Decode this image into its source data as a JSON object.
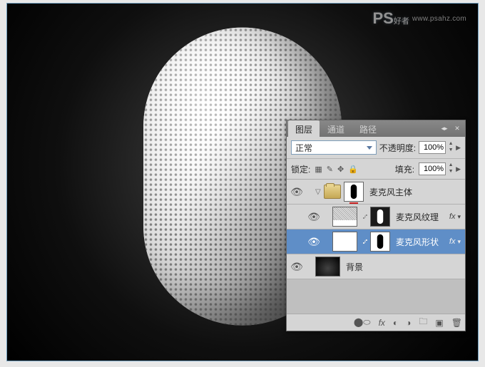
{
  "watermark": {
    "logo": "PS",
    "logo_suffix": "好者",
    "url": "www.psahz.com"
  },
  "panel": {
    "tabs": {
      "layers": "图层",
      "channels": "通道",
      "paths": "路径"
    },
    "blend_mode": "正常",
    "opacity_label": "不透明度:",
    "opacity_value": "100%",
    "lock_label": "锁定:",
    "fill_label": "填充:",
    "fill_value": "100%"
  },
  "layers": {
    "group": "麦克风主体",
    "texture": "麦克风纹理",
    "shape": "麦克风形状",
    "background": "背景"
  },
  "fx": "fx"
}
